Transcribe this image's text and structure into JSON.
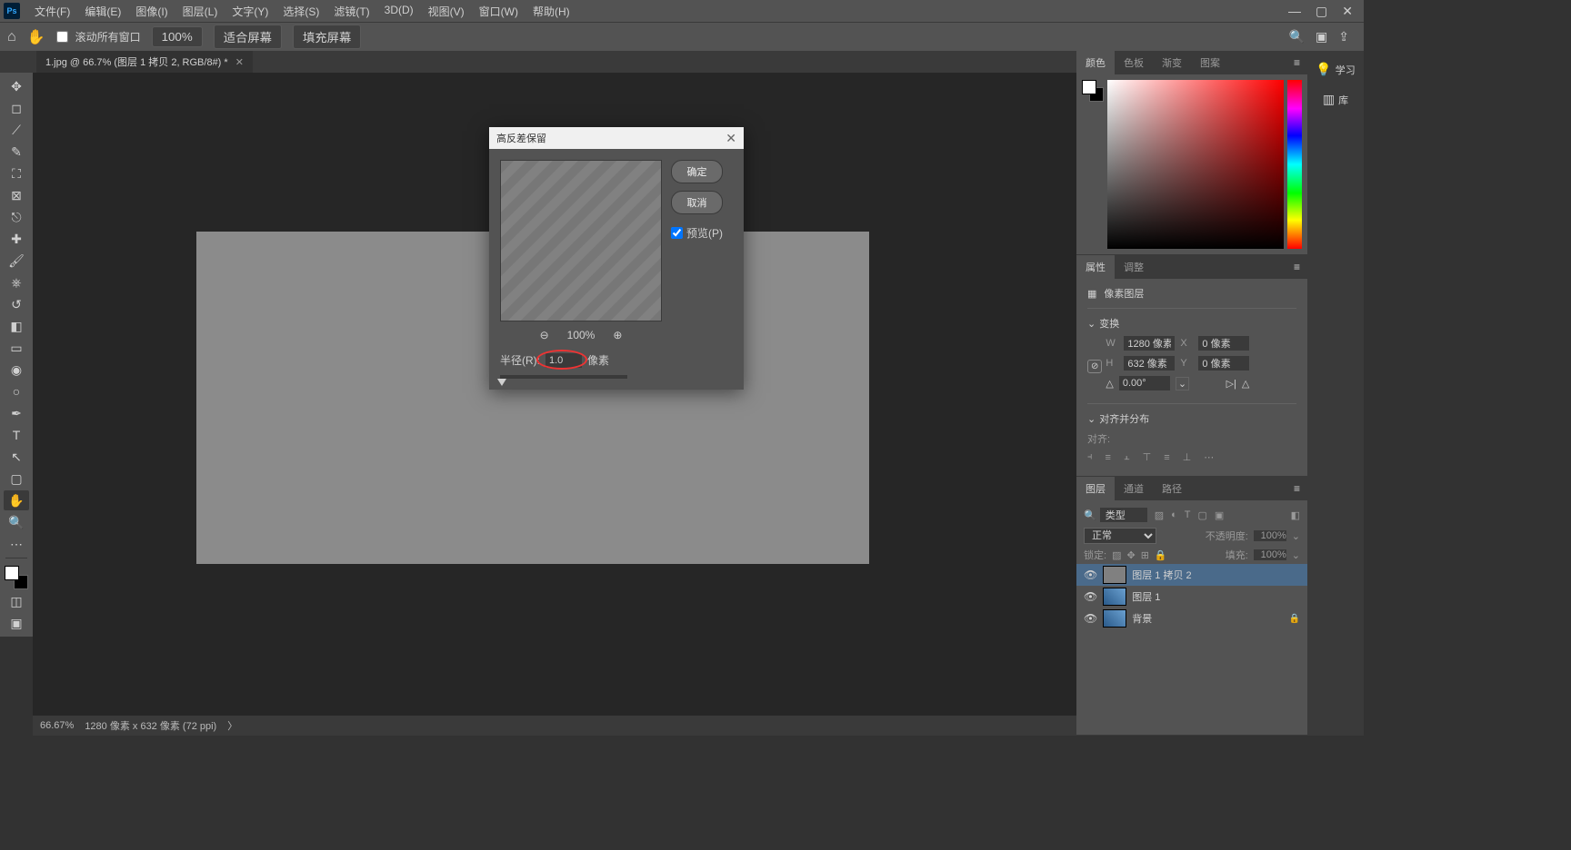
{
  "menu": {
    "items": [
      "文件(F)",
      "编辑(E)",
      "图像(I)",
      "图层(L)",
      "文字(Y)",
      "选择(S)",
      "滤镜(T)",
      "3D(D)",
      "视图(V)",
      "窗口(W)",
      "帮助(H)"
    ]
  },
  "opt": {
    "scroll_all": "滚动所有窗口",
    "zoom": "100%",
    "fit_screen": "适合屏幕",
    "fill_screen": "填充屏幕"
  },
  "doc": {
    "tab": "1.jpg @ 66.7% (图层 1 拷贝 2, RGB/8#) *"
  },
  "tools": [
    {
      "name": "move",
      "glyph": "✥"
    },
    {
      "name": "marquee",
      "glyph": "◻"
    },
    {
      "name": "lasso",
      "glyph": "⟋"
    },
    {
      "name": "quick-select",
      "glyph": "✎"
    },
    {
      "name": "crop",
      "glyph": "⛶"
    },
    {
      "name": "frame",
      "glyph": "⊠"
    },
    {
      "name": "eyedropper",
      "glyph": "⎋"
    },
    {
      "name": "healing",
      "glyph": "✚"
    },
    {
      "name": "brush",
      "glyph": "🖌"
    },
    {
      "name": "stamp",
      "glyph": "⎈"
    },
    {
      "name": "history-brush",
      "glyph": "↺"
    },
    {
      "name": "eraser",
      "glyph": "◧"
    },
    {
      "name": "gradient",
      "glyph": "▭"
    },
    {
      "name": "blur",
      "glyph": "◉"
    },
    {
      "name": "dodge",
      "glyph": "○"
    },
    {
      "name": "pen",
      "glyph": "✒"
    },
    {
      "name": "type",
      "glyph": "T"
    },
    {
      "name": "path-select",
      "glyph": "↖"
    },
    {
      "name": "shape",
      "glyph": "▢"
    },
    {
      "name": "hand",
      "glyph": "✋",
      "active": true
    },
    {
      "name": "zoom",
      "glyph": "🔍"
    },
    {
      "name": "more",
      "glyph": "⋯"
    }
  ],
  "edge": {
    "learn_label": "学习",
    "library_label": "库"
  },
  "color_panel": {
    "tabs": [
      "颜色",
      "色板",
      "渐变",
      "图案"
    ]
  },
  "props_panel": {
    "tabs": [
      "属性",
      "调整"
    ],
    "type_label": "像素图层",
    "transform_title": "变换",
    "w_label": "W",
    "w_value": "1280 像素",
    "x_label": "X",
    "x_value": "0 像素",
    "h_label": "H",
    "h_value": "632 像素",
    "y_label": "Y",
    "y_value": "0 像素",
    "angle_value": "0.00°",
    "align_title": "对齐并分布",
    "align_label": "对齐:"
  },
  "layers_panel": {
    "tabs": [
      "图层",
      "通道",
      "路径"
    ],
    "search_placeholder": "类型",
    "blend_mode": "正常",
    "opacity_label": "不透明度:",
    "opacity_value": "100%",
    "lock_label": "锁定:",
    "fill_label": "填充:",
    "fill_value": "100%",
    "layers": [
      {
        "name": "图层 1 拷贝 2",
        "selected": true,
        "gray": true,
        "locked": false
      },
      {
        "name": "图层 1",
        "selected": false,
        "gray": false,
        "locked": false
      },
      {
        "name": "背景",
        "selected": false,
        "gray": false,
        "locked": true
      }
    ]
  },
  "dialog": {
    "title": "高反差保留",
    "ok": "确定",
    "cancel": "取消",
    "preview_label": "预览(P)",
    "zoom_value": "100%",
    "radius_label": "半径(R):",
    "radius_value": "1.0",
    "radius_unit": "像素"
  },
  "status": {
    "zoom": "66.67%",
    "dims": "1280 像素 x 632 像素 (72 ppi)"
  }
}
